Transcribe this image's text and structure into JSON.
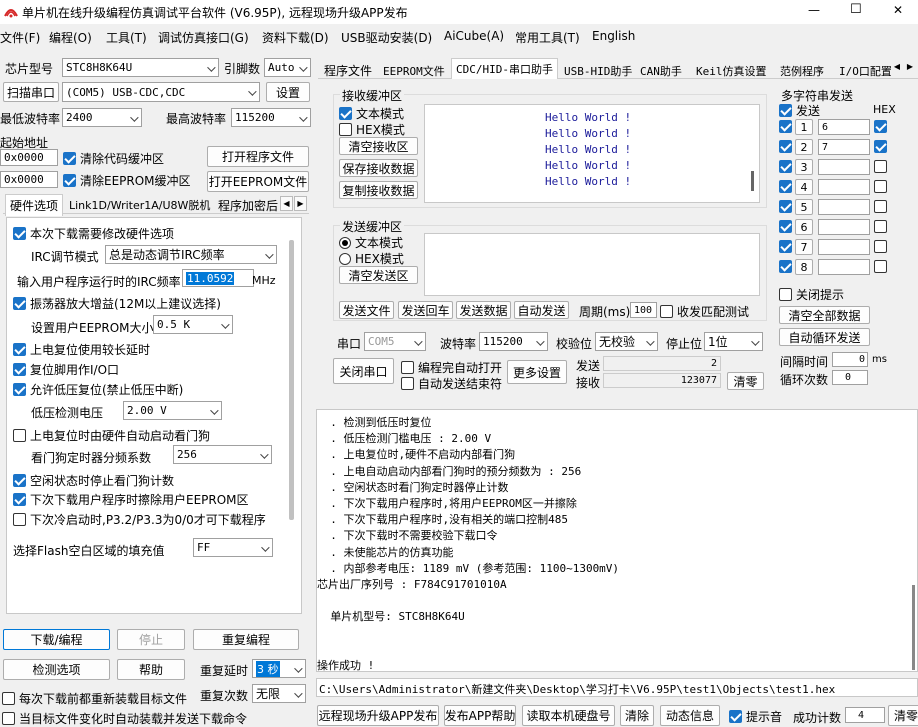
{
  "window": {
    "title": "单片机在线升级编程仿真调试平台软件 (V6.95P), 远程现场升级APP发布",
    "min": "—",
    "max": "☐",
    "close": "✕"
  },
  "menu": [
    "文件(F)",
    "编程(O)",
    "工具(T)",
    "调试仿真接口(G)",
    "资料下载(D)",
    "USB驱动安装(D)",
    "AiCube(A)",
    "常用工具(T)",
    "English"
  ],
  "left": {
    "chip_label": "芯片型号",
    "chip_value": "STC8H8K64U",
    "pins_label": "引脚数",
    "pins_value": "Auto",
    "scan_port": "扫描串口",
    "port_value": "(COM5) USB-CDC,CDC",
    "settings": "设置",
    "min_baud_label": "最低波特率",
    "min_baud": "2400",
    "max_baud_label": "最高波特率",
    "max_baud": "115200",
    "start_addr_label": "起始地址",
    "addr1": "0x0000",
    "clear_code": "清除代码缓冲区",
    "open_prog": "打开程序文件",
    "addr2": "0x0000",
    "clear_eeprom": "清除EEPROM缓冲区",
    "open_eeprom": "打开EEPROM文件",
    "tabs": [
      "硬件选项",
      "Link1D/Writer1A/U8W脱机",
      "程序加密后"
    ],
    "opts": {
      "o1": "本次下载需要修改硬件选项",
      "irc_label": "IRC调节模式",
      "irc_value": "总是动态调节IRC频率",
      "freq_label": "输入用户程序运行时的IRC频率",
      "freq_value": "11.0592",
      "freq_unit": "MHz",
      "o2": "振荡器放大增益(12M以上建议选择)",
      "eeprom_label": "设置用户EEPROM大小",
      "eeprom_value": "0.5 K",
      "o3": "上电复位使用较长延时",
      "o4": "复位脚用作I/O口",
      "o5": "允许低压复位(禁止低压中断)",
      "lvd_label": "低压检测电压",
      "lvd_value": "2.00 V",
      "o6": "上电复位时由硬件自动启动看门狗",
      "wdt_label": "看门狗定时器分频系数",
      "wdt_value": "256",
      "o7": "空闲状态时停止看门狗计数",
      "o8": "下次下载用户程序时擦除用户EEPROM区",
      "o9": "下次冷启动时,P3.2/P3.3为0/0才可下载程序",
      "fill_label": "选择Flash空白区域的填充值",
      "fill_value": "FF"
    },
    "download": "下载/编程",
    "stop": "停止",
    "reprogram": "重复编程",
    "check": "检测选项",
    "help": "帮助",
    "delay_label": "重复延时",
    "delay_value": "3 秒",
    "count_label": "重复次数",
    "count_value": "无限",
    "reload": "每次下载前都重新装载目标文件",
    "autoload": "当目标文件变化时自动装载并发送下载命令"
  },
  "right": {
    "tabs": [
      "程序文件",
      "EEPROM文件",
      "CDC/HID-串口助手",
      "USB-HID助手",
      "CAN助手",
      "Keil仿真设置",
      "范例程序",
      "I/O口配置"
    ],
    "recv": {
      "title": "接收缓冲区",
      "text_mode": "文本模式",
      "hex_mode": "HEX模式",
      "clear": "清空接收区",
      "save": "保存接收数据",
      "copy": "复制接收数据",
      "lines": [
        "Hello World !",
        "Hello World !",
        "Hello World !",
        "Hello World !",
        "Hello World !"
      ]
    },
    "send": {
      "title": "发送缓冲区",
      "text_mode": "文本模式",
      "hex_mode": "HEX模式",
      "clear": "清空发送区",
      "send_file": "发送文件",
      "send_cr": "发送回车",
      "send_data": "发送数据",
      "auto_send": "自动发送",
      "period_label": "周期(ms)",
      "period_value": "100",
      "match": "收发匹配测试"
    },
    "port_label": "串口",
    "port_value": "COM5",
    "baud_label": "波特率",
    "baud_value": "115200",
    "parity_label": "校验位",
    "parity_value": "无校验",
    "stop_label": "停止位",
    "stop_value": "1位",
    "close_port": "关闭串口",
    "auto_open": "编程完自动打开",
    "auto_end": "自动发送结束符",
    "more": "更多设置",
    "tx_label": "发送",
    "tx_value": "2",
    "rx_label": "接收",
    "rx_value": "123077",
    "clear_cnt": "清零",
    "multi": {
      "title": "多字符串发送",
      "send_hdr": "发送",
      "hex_hdr": "HEX",
      "rows": [
        {
          "n": "1",
          "v": "6"
        },
        {
          "n": "2",
          "v": "7"
        },
        {
          "n": "3",
          "v": ""
        },
        {
          "n": "4",
          "v": ""
        },
        {
          "n": "5",
          "v": ""
        },
        {
          "n": "6",
          "v": ""
        },
        {
          "n": "7",
          "v": ""
        },
        {
          "n": "8",
          "v": ""
        }
      ],
      "close_tip": "关闭提示",
      "clear_all": "清空全部数据",
      "auto_loop": "自动循环发送",
      "interval_label": "间隔时间",
      "interval_value": "0",
      "interval_unit": "ms",
      "loop_label": "循环次数",
      "loop_value": "0"
    },
    "log": [
      "  . 检测到低压时复位",
      "  . 低压检测门槛电压 : 2.00 V",
      "  . 上电复位时,硬件不启动内部看门狗",
      "  . 上电自动启动内部看门狗时的预分频数为 : 256",
      "  . 空闲状态时看门狗定时器停止计数",
      "  . 下次下载用户程序时,将用户EEPROM区一并擦除",
      "  . 下次下载用户程序时,没有相关的端口控制485",
      "  . 下次下载时不需要校验下载口令",
      "  . 未使能芯片的仿真功能",
      "  . 内部参考电压: 1189 mV (参考范围: 1100~1300mV)",
      "芯片出厂序列号 : F784C91701010A",
      "",
      "  单片机型号: STC8H8K64U",
      "",
      "",
      "操作成功 !"
    ],
    "path": "C:\\Users\\Administrator\\新建文件夹\\Desktop\\学习打卡\\V6.95P\\test1\\Objects\\test1.hex"
  },
  "bottom": {
    "publish": "远程现场升级APP发布",
    "publish_help": "发布APP帮助",
    "read_disk": "读取本机硬盘号",
    "clear": "清除",
    "dynamic": "动态信息",
    "tip_sound": "提示音",
    "success_label": "成功计数",
    "success_value": "4",
    "clear_zero": "清零"
  },
  "colors": {
    "selection": "#0078d7",
    "hello": "#1b1b9a",
    "check": "#1a73c8"
  }
}
